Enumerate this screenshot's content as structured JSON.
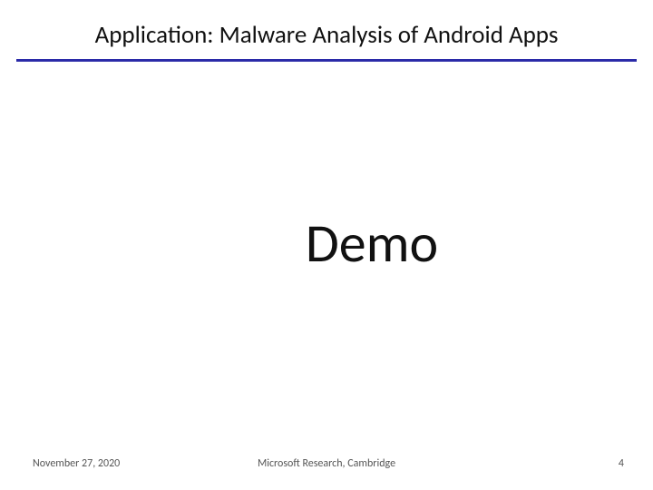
{
  "title": "Application: Malware Analysis of Android Apps",
  "body": "Demo",
  "footer": {
    "date": "November 27, 2020",
    "affiliation": "Microsoft Research, Cambridge",
    "page": "4"
  }
}
